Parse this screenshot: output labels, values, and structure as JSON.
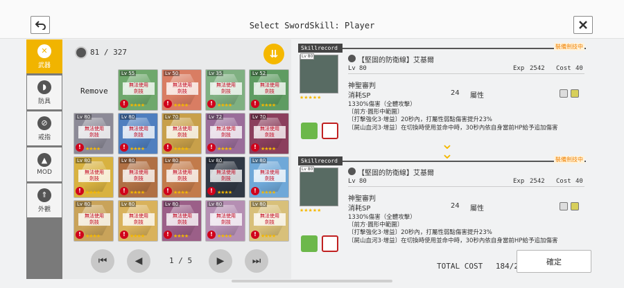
{
  "header": {
    "title": "Select SwordSkill: Player"
  },
  "sidebar": {
    "items": [
      {
        "label": "武器",
        "icon": "crossed-swords-icon",
        "active": true
      },
      {
        "label": "防具",
        "icon": "shield-icon"
      },
      {
        "label": "戒指",
        "icon": "ring-icon"
      },
      {
        "label": "MOD",
        "icon": "triangle-mod-icon"
      },
      {
        "label": "外觀",
        "icon": "costume-icon"
      }
    ]
  },
  "inventory": {
    "count": "81 / 327",
    "remove_label": "Remove",
    "locked_text": "無法使用\n劍技",
    "cards": [
      {
        "level": "Lv 55",
        "color": "#6fa86c"
      },
      {
        "level": "Lv 50",
        "color": "#d97d63"
      },
      {
        "level": "Lv 35",
        "color": "#7fb081"
      },
      {
        "level": "Lv 52",
        "color": "#5f9c62"
      },
      {
        "level": "Lv 80",
        "color": "#8c8a97"
      },
      {
        "level": "Lv 80",
        "color": "#4f7fbf"
      },
      {
        "level": "Lv 70",
        "color": "#c8a04a"
      },
      {
        "level": "Lv 72",
        "color": "#9a6d9a"
      },
      {
        "level": "Lv 70",
        "color": "#8b3f5d"
      },
      {
        "level": "Lv 80",
        "color": "#d8b240"
      },
      {
        "level": "Lv 80",
        "color": "#b07044"
      },
      {
        "level": "Lv 80",
        "color": "#c27b4b"
      },
      {
        "level": "Lv 80",
        "color": "#303844"
      },
      {
        "level": "Lv 80",
        "color": "#6fa8d8"
      },
      {
        "level": "Lv 80",
        "color": "#c9a35a"
      },
      {
        "level": "Lv 80",
        "color": "#d9b25c"
      },
      {
        "level": "Lv 80",
        "color": "#9b5f88"
      },
      {
        "level": "Lv 80",
        "color": "#b58fb3"
      },
      {
        "level": "Lv 80",
        "color": "#d8c07a"
      }
    ]
  },
  "pager": {
    "indicator": "1 / 5",
    "first": "first-page",
    "prev": "prev-page",
    "next": "next-page",
    "last": "last-page"
  },
  "skillrecords": [
    {
      "tab": "Skillrecord",
      "equipped": "裝備劍技中",
      "portrait_lv": "Lv 80",
      "name": "【堅固的防衛線】艾基爾",
      "lv_label": "Lv",
      "lv_value": "80",
      "exp_label": "Exp",
      "exp_value": "2542",
      "cost_label": "Cost",
      "cost_value": "40",
      "skill": "神聖審判",
      "sp_label": "消耗SP",
      "sp_value": "24",
      "attr_label": "屬性",
      "desc": [
        "1330%傷害（全體攻擊）",
        "〔前方·圓形中範圍〕",
        "〔打擊強化3·增益〕20秒內，打屬性弱點傷害提升23%",
        "〔屍山血河3·增益〕在切換時使用並命中時，30秒內依自身當前HP給予追加傷害"
      ]
    },
    {
      "tab": "Skillrecord",
      "equipped": "裝備劍技中",
      "portrait_lv": "Lv 80",
      "name": "【堅固的防衛線】艾基爾",
      "lv_label": "Lv",
      "lv_value": "80",
      "exp_label": "Exp",
      "exp_value": "2542",
      "cost_label": "Cost",
      "cost_value": "40",
      "skill": "神聖審判",
      "sp_label": "消耗SP",
      "sp_value": "24",
      "attr_label": "屬性",
      "desc": [
        "1330%傷害（全體攻擊）",
        "〔前方·圓形中範圍〕",
        "〔打擊強化3·增益〕20秒內，打屬性弱點傷害提升23%",
        "〔屍山血河3·增益〕在切換時使用並命中時，30秒內依自身當前HP給予追加傷害"
      ]
    }
  ],
  "footer": {
    "total_label": "TOTAL COST",
    "total_value": "184/260",
    "confirm_label": "確定"
  },
  "colors": {
    "accent": "#f1b400",
    "danger": "#d0021b",
    "equipped": "#f08000"
  }
}
